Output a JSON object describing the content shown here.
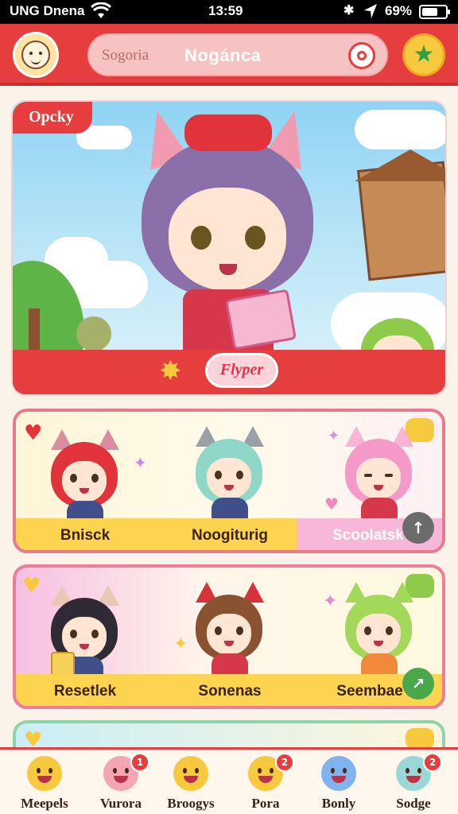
{
  "status_bar": {
    "carrier": "UNG Dnena",
    "time": "13:59",
    "battery_percent": "69%",
    "battery_level": 0.69,
    "icons": [
      "wifi-icon",
      "bluetooth-icon",
      "location-arrow-icon",
      "battery-icon"
    ]
  },
  "header": {
    "search": {
      "placeholder": "Sogoria",
      "value": "Nogánca"
    },
    "icons": [
      "avatar-icon",
      "target-icon",
      "star-icon"
    ],
    "accent_color": "#e63e3e"
  },
  "hero": {
    "badge": "Opcky",
    "button_label": "Flyper",
    "icons": [
      "sparkle-icon"
    ]
  },
  "cards": [
    {
      "characters": [
        {
          "name": "Bnisck",
          "hair": "#e0333a",
          "ear": "#d98ea0",
          "outfit": "#3f4f8a"
        },
        {
          "name": "Noogiturig",
          "hair": "#8fd8c8",
          "ear": "#9aa0a8",
          "outfit": "#3f4f8a"
        },
        {
          "name": "Scoolatsk",
          "hair": "#f59ac8",
          "ear": "#f7b4d4",
          "outfit": "#d7374a"
        }
      ],
      "nav_symbol": "↑"
    },
    {
      "characters": [
        {
          "name": "Resetlek",
          "hair": "#2f2a33",
          "ear": "#e9c8b8",
          "outfit": "#3f4f8a"
        },
        {
          "name": "Sonenas",
          "hair": "#8a5230",
          "ear": "#d8323a",
          "outfit": "#d7374a"
        },
        {
          "name": "Seembae",
          "hair": "#a4d85a",
          "ear": "#a4d85a",
          "outfit": "#f08a3a"
        }
      ],
      "nav_symbol": "↗"
    }
  ],
  "bottom_nav": [
    {
      "label": "Meepels",
      "badge": "",
      "color": "#f7c93e"
    },
    {
      "label": "Vurora",
      "badge": "1",
      "color": "#f6a5b5"
    },
    {
      "label": "Broogys",
      "badge": "",
      "color": "#f7c93e"
    },
    {
      "label": "Pora",
      "badge": "2",
      "color": "#f7c93e"
    },
    {
      "label": "Bonly",
      "badge": "",
      "color": "#7fb4f0"
    },
    {
      "label": "Sodge",
      "badge": "2",
      "color": "#9ad8d8"
    }
  ]
}
